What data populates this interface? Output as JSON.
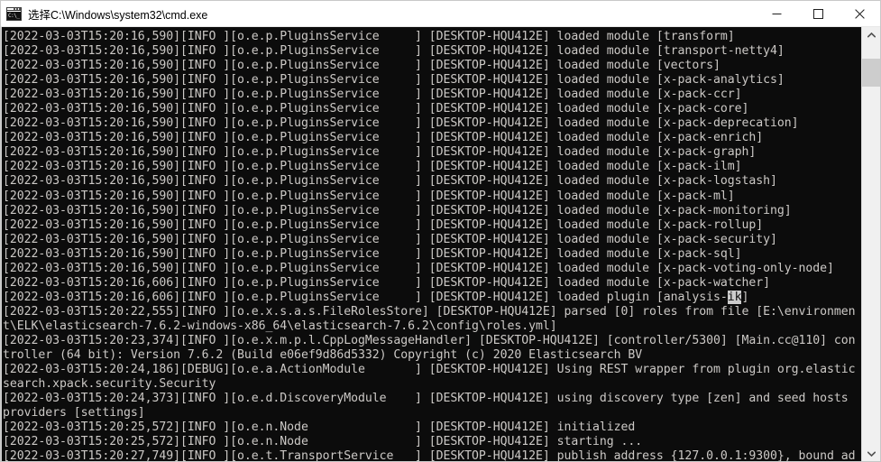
{
  "window": {
    "title": "选择C:\\Windows\\system32\\cmd.exe",
    "icon": "cmd-icon",
    "icon_glyph": "C:\\_",
    "controls": {
      "minimize_label": "Minimize",
      "maximize_label": "Maximize",
      "close_label": "Close"
    }
  },
  "theme": {
    "console_background": "#0c0c0c",
    "console_foreground": "#ccc9c6",
    "selection_background": "#cccccc",
    "selection_foreground": "#0c0c0c",
    "titlebar_background": "#ffffff",
    "scrollbar_track": "#f0f0f0",
    "scrollbar_thumb": "#cdcdcd"
  },
  "scrollbar": {
    "up_arrow": "chevron-up-icon",
    "down_arrow": "chevron-down-icon",
    "thumb_top_pct": 4,
    "thumb_height_pct": 7
  },
  "console": {
    "lines": [
      "[2022-03-03T15:20:16,590][INFO ][o.e.p.PluginsService     ] [DESKTOP-HQU412E] loaded module [transform]",
      "[2022-03-03T15:20:16,590][INFO ][o.e.p.PluginsService     ] [DESKTOP-HQU412E] loaded module [transport-netty4]",
      "[2022-03-03T15:20:16,590][INFO ][o.e.p.PluginsService     ] [DESKTOP-HQU412E] loaded module [vectors]",
      "[2022-03-03T15:20:16,590][INFO ][o.e.p.PluginsService     ] [DESKTOP-HQU412E] loaded module [x-pack-analytics]",
      "[2022-03-03T15:20:16,590][INFO ][o.e.p.PluginsService     ] [DESKTOP-HQU412E] loaded module [x-pack-ccr]",
      "[2022-03-03T15:20:16,590][INFO ][o.e.p.PluginsService     ] [DESKTOP-HQU412E] loaded module [x-pack-core]",
      "[2022-03-03T15:20:16,590][INFO ][o.e.p.PluginsService     ] [DESKTOP-HQU412E] loaded module [x-pack-deprecation]",
      "[2022-03-03T15:20:16,590][INFO ][o.e.p.PluginsService     ] [DESKTOP-HQU412E] loaded module [x-pack-enrich]",
      "[2022-03-03T15:20:16,590][INFO ][o.e.p.PluginsService     ] [DESKTOP-HQU412E] loaded module [x-pack-graph]",
      "[2022-03-03T15:20:16,590][INFO ][o.e.p.PluginsService     ] [DESKTOP-HQU412E] loaded module [x-pack-ilm]",
      "[2022-03-03T15:20:16,590][INFO ][o.e.p.PluginsService     ] [DESKTOP-HQU412E] loaded module [x-pack-logstash]",
      "[2022-03-03T15:20:16,590][INFO ][o.e.p.PluginsService     ] [DESKTOP-HQU412E] loaded module [x-pack-ml]",
      "[2022-03-03T15:20:16,590][INFO ][o.e.p.PluginsService     ] [DESKTOP-HQU412E] loaded module [x-pack-monitoring]",
      "[2022-03-03T15:20:16,590][INFO ][o.e.p.PluginsService     ] [DESKTOP-HQU412E] loaded module [x-pack-rollup]",
      "[2022-03-03T15:20:16,590][INFO ][o.e.p.PluginsService     ] [DESKTOP-HQU412E] loaded module [x-pack-security]",
      "[2022-03-03T15:20:16,590][INFO ][o.e.p.PluginsService     ] [DESKTOP-HQU412E] loaded module [x-pack-sql]",
      "[2022-03-03T15:20:16,590][INFO ][o.e.p.PluginsService     ] [DESKTOP-HQU412E] loaded module [x-pack-voting-only-node]",
      "[2022-03-03T15:20:16,606][INFO ][o.e.p.PluginsService     ] [DESKTOP-HQU412E] loaded module [x-pack-watcher]",
      "[2022-03-03T15:20:16,606][INFO ][o.e.p.PluginsService     ] [DESKTOP-HQU412E] loaded plugin [analysis-ik]",
      "[2022-03-03T15:20:22,555][INFO ][o.e.x.s.a.s.FileRolesStore] [DESKTOP-HQU412E] parsed [0] roles from file [E:\\environmen",
      "t\\ELK\\elasticsearch-7.6.2-windows-x86_64\\elasticsearch-7.6.2\\config\\roles.yml]",
      "[2022-03-03T15:20:23,374][INFO ][o.e.x.m.p.l.CppLogMessageHandler] [DESKTOP-HQU412E] [controller/5300] [Main.cc@110] con",
      "troller (64 bit): Version 7.6.2 (Build e06ef9d86d5332) Copyright (c) 2020 Elasticsearch BV",
      "[2022-03-03T15:20:24,186][DEBUG][o.e.a.ActionModule       ] [DESKTOP-HQU412E] Using REST wrapper from plugin org.elastic",
      "search.xpack.security.Security",
      "[2022-03-03T15:20:24,373][INFO ][o.e.d.DiscoveryModule    ] [DESKTOP-HQU412E] using discovery type [zen] and seed hosts",
      "providers [settings]",
      "[2022-03-03T15:20:25,572][INFO ][o.e.n.Node               ] [DESKTOP-HQU412E] initialized",
      "[2022-03-03T15:20:25,572][INFO ][o.e.n.Node               ] [DESKTOP-HQU412E] starting ...",
      "[2022-03-03T15:20:27,749][INFO ][o.e.t.TransportService   ] [DESKTOP-HQU412E] publish_address {127.0.0.1:9300}, bound_ad"
    ],
    "selection": {
      "line_index": 18,
      "text": "ik",
      "prefix": "[2022-03-03T15:20:16,606][INFO ][o.e.p.PluginsService     ] [DESKTOP-HQU412E] loaded plugin [analysis-",
      "suffix": "]"
    }
  }
}
